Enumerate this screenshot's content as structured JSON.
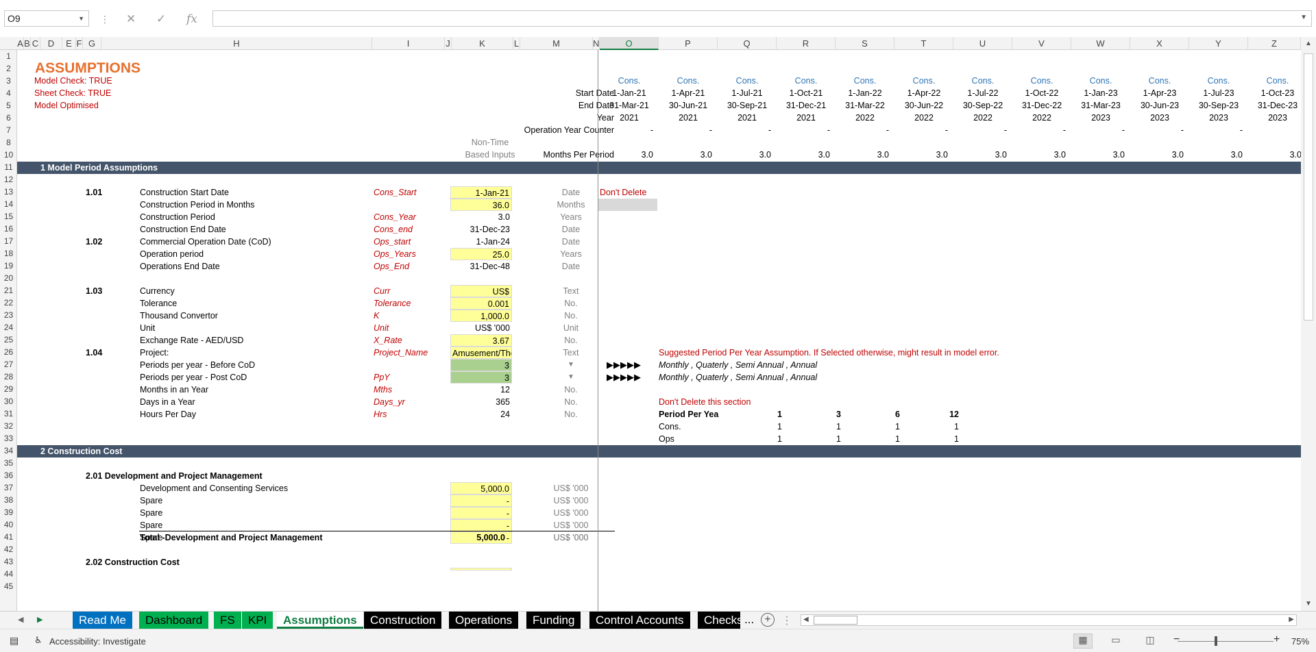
{
  "formula_bar": {
    "name_box": "O9",
    "formula": ""
  },
  "columns": [
    "A",
    "B",
    "C",
    "D",
    "E",
    "F",
    "G",
    "H",
    "I",
    "J",
    "K",
    "L",
    "M",
    "N",
    "O",
    "P",
    "Q",
    "R",
    "S",
    "T",
    "U",
    "V",
    "W",
    "X",
    "Y",
    "Z"
  ],
  "rows": [
    "1",
    "2",
    "3",
    "4",
    "5",
    "6",
    "7",
    "8",
    "10",
    "11",
    "12",
    "13",
    "14",
    "15",
    "16",
    "17",
    "18",
    "19",
    "20",
    "21",
    "22",
    "23",
    "24",
    "25",
    "26",
    "27",
    "28",
    "29",
    "30",
    "31",
    "32",
    "33",
    "34",
    "35",
    "36",
    "37",
    "38",
    "39",
    "40",
    "41",
    "42",
    "43",
    "44",
    "45"
  ],
  "header": {
    "title": "ASSUMPTIONS",
    "model_check": "Model Check: TRUE",
    "sheet_check": "Sheet Check: TRUE",
    "model_optimised": "Model Optimised",
    "start_date_label": "Start Date",
    "end_date_label": "End Date",
    "year_label": "Year",
    "op_year_counter_label": "Operation Year Counter",
    "non_time_1": "Non-Time",
    "non_time_2": "Based Inputs",
    "months_per_period_label": "Months Per Period"
  },
  "timeline": [
    {
      "phase": "Cons.",
      "start": "1-Jan-21",
      "end": "31-Mar-21",
      "year": "2021",
      "counter": "-",
      "months": "3.0"
    },
    {
      "phase": "Cons.",
      "start": "1-Apr-21",
      "end": "30-Jun-21",
      "year": "2021",
      "counter": "-",
      "months": "3.0"
    },
    {
      "phase": "Cons.",
      "start": "1-Jul-21",
      "end": "30-Sep-21",
      "year": "2021",
      "counter": "-",
      "months": "3.0"
    },
    {
      "phase": "Cons.",
      "start": "1-Oct-21",
      "end": "31-Dec-21",
      "year": "2021",
      "counter": "-",
      "months": "3.0"
    },
    {
      "phase": "Cons.",
      "start": "1-Jan-22",
      "end": "31-Mar-22",
      "year": "2022",
      "counter": "-",
      "months": "3.0"
    },
    {
      "phase": "Cons.",
      "start": "1-Apr-22",
      "end": "30-Jun-22",
      "year": "2022",
      "counter": "-",
      "months": "3.0"
    },
    {
      "phase": "Cons.",
      "start": "1-Jul-22",
      "end": "30-Sep-22",
      "year": "2022",
      "counter": "-",
      "months": "3.0"
    },
    {
      "phase": "Cons.",
      "start": "1-Oct-22",
      "end": "31-Dec-22",
      "year": "2022",
      "counter": "-",
      "months": "3.0"
    },
    {
      "phase": "Cons.",
      "start": "1-Jan-23",
      "end": "31-Mar-23",
      "year": "2023",
      "counter": "-",
      "months": "3.0"
    },
    {
      "phase": "Cons.",
      "start": "1-Apr-23",
      "end": "30-Jun-23",
      "year": "2023",
      "counter": "-",
      "months": "3.0"
    },
    {
      "phase": "Cons.",
      "start": "1-Jul-23",
      "end": "30-Sep-23",
      "year": "2023",
      "counter": "-",
      "months": "3.0"
    },
    {
      "phase": "Cons.",
      "start": "1-Oct-23",
      "end": "31-Dec-23",
      "year": "2023",
      "counter": "",
      "months": "3.0"
    }
  ],
  "section1": {
    "title": "1  Model Period Assumptions",
    "g101": "1.01",
    "g102": "1.02",
    "g103": "1.03",
    "g104": "1.04",
    "rows": [
      {
        "label": "Construction Start Date",
        "name": "Cons_Start",
        "value": "1-Jan-21",
        "unit": "Date"
      },
      {
        "label": "Construction Period in Months",
        "name": "",
        "value": "36.0",
        "unit": "Months"
      },
      {
        "label": "Construction Period",
        "name": "Cons_Year",
        "value": "3.0",
        "unit": "Years"
      },
      {
        "label": "Construction End Date",
        "name": "Cons_end",
        "value": "31-Dec-23",
        "unit": "Date"
      },
      {
        "label": "Commercial Operation Date (CoD)",
        "name": "Ops_start",
        "value": "1-Jan-24",
        "unit": "Date"
      },
      {
        "label": "Operation period",
        "name": "Ops_Years",
        "value": "25.0",
        "unit": "Years"
      },
      {
        "label": "Operations End Date",
        "name": "Ops_End",
        "value": "31-Dec-48",
        "unit": "Date"
      },
      {
        "label": "Currency",
        "name": "Curr",
        "value": "US$",
        "unit": "Text"
      },
      {
        "label": "Tolerance",
        "name": "Tolerance",
        "value": "0.001",
        "unit": "No."
      },
      {
        "label": "Thousand Convertor",
        "name": "K",
        "value": "1,000.0",
        "unit": "No."
      },
      {
        "label": "Unit",
        "name": "Unit",
        "value": "US$ '000",
        "unit": "Unit"
      },
      {
        "label": "Exchange Rate - AED/USD",
        "name": "X_Rate",
        "value": "3.67",
        "unit": "No."
      },
      {
        "label": "Project:",
        "name": "Project_Name",
        "value": "Amusement/Then",
        "unit": "Text"
      },
      {
        "label": "Periods per year - Before CoD",
        "name": "",
        "value": "3",
        "unit": ""
      },
      {
        "label": "Periods per year - Post CoD",
        "name": "PpY",
        "value": "3",
        "unit": ""
      },
      {
        "label": "Months in an Year",
        "name": "Mths",
        "value": "12",
        "unit": "No."
      },
      {
        "label": "Days in a Year",
        "name": "Days_yr",
        "value": "365",
        "unit": "No."
      },
      {
        "label": "Hours Per Day",
        "name": "Hrs",
        "value": "24",
        "unit": "No."
      }
    ],
    "dont_delete": "Don't Delete",
    "suggested": "Suggested Period Per Year Assumption. If Selected otherwise, might result in model error.",
    "arrows": "▶▶▶▶▶",
    "options": "Monthly ,  Quaterly ,  Semi Annual ,  Annual",
    "dont_delete_section": "Don't Delete this section",
    "ppy_table": {
      "header": "Period Per Yea",
      "cols": [
        "1",
        "3",
        "6",
        "12"
      ],
      "cons_label": "Cons.",
      "cons": [
        "1",
        "1",
        "1",
        "1"
      ],
      "ops_label": "Ops",
      "ops": [
        "1",
        "1",
        "1",
        "1"
      ]
    }
  },
  "section2": {
    "title": "2  Construction Cost",
    "sub201": "2.01  Development and Project Management",
    "rows": [
      {
        "label": "Development and Consenting Services",
        "value": "5,000.0",
        "unit": "US$ '000"
      },
      {
        "label": "Spare",
        "value": "-",
        "unit": "US$ '000"
      },
      {
        "label": "Spare",
        "value": "-",
        "unit": "US$ '000"
      },
      {
        "label": "Spare",
        "value": "-",
        "unit": "US$ '000"
      },
      {
        "label": "Spare",
        "value": "-",
        "unit": "US$ '000"
      }
    ],
    "total_label": "Total -Development and Project Management",
    "total_value": "5,000.0",
    "total_unit": "US$ '000",
    "sub202": "2.02  Construction Cost"
  },
  "tabs": [
    "Read Me",
    "Dashboard",
    "FS",
    "KPI",
    "Assumptions",
    "Construction",
    "Operations",
    "Funding",
    "Control Accounts",
    "Checks"
  ],
  "tabs_more": "...",
  "status": {
    "accessibility": "Accessibility: Investigate",
    "zoom": "75%"
  }
}
